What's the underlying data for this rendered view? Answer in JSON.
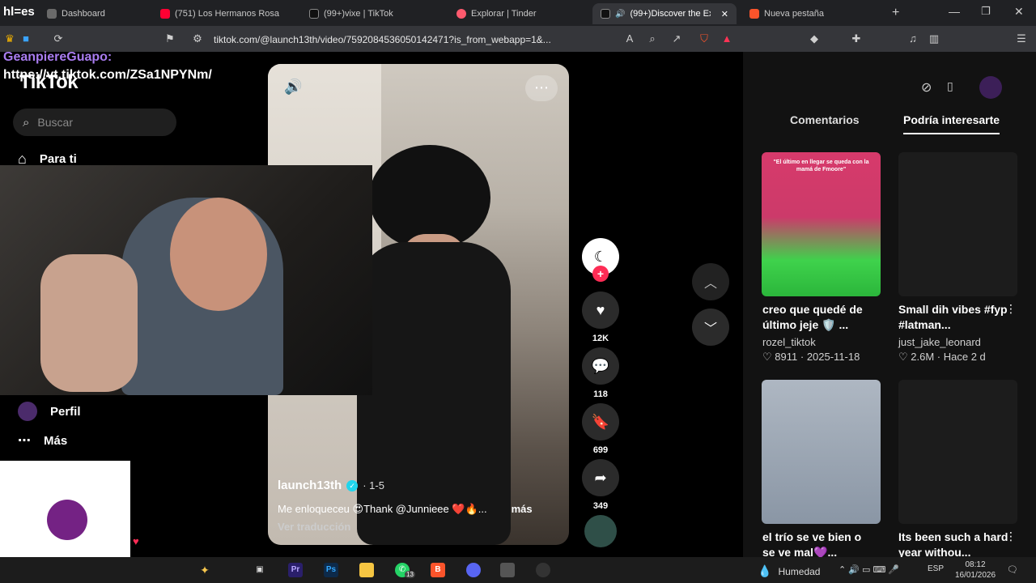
{
  "tabs": [
    {
      "label": "Dashboard"
    },
    {
      "label": "(751) Los Hermanos Rosa"
    },
    {
      "label": "(99+)vixe | TikTok"
    },
    {
      "label": "Explorar | Tinder"
    },
    {
      "label": "(99+)Discover the Ex"
    },
    {
      "label": "Nueva pestaña"
    }
  ],
  "address": {
    "url": "tiktok.com/@launch13th/video/7592084536050142471?is_from_webapp=1&..."
  },
  "overlay": {
    "hl_tag": "hl=es",
    "chat_user": "GeanpiereGuapo:",
    "chat_message": "https://vt.tiktok.com/ZSa1NPYNm/"
  },
  "tiktok": {
    "logo": "TikTok",
    "search_placeholder": "Buscar",
    "nav": [
      {
        "label": "Para ti"
      },
      {
        "label": "Perfil"
      },
      {
        "label": "Más"
      }
    ]
  },
  "video": {
    "author": "launch13th",
    "date": "· 1-5",
    "caption": "Me enloqueceu 😍Thank @Junnieee ❤️🔥...",
    "more": "más",
    "translate": "Ver traducción",
    "likes": "12K",
    "comments": "118",
    "saves": "699",
    "shares": "349"
  },
  "panel": {
    "tab_comments": "Comentarios",
    "tab_interest": "Podría interesarte",
    "cards": [
      {
        "title": "creo que quedé de último jeje 🛡️ ...",
        "author": "rozel_tiktok",
        "likes": "8911",
        "date": "2025-11-18",
        "thumb_text": "\"El último en llegar se queda con la mamá de Fmoore\""
      },
      {
        "title": "Small dih vibes #fyp #latman...",
        "author": "just_jake_leonard",
        "likes": "2.6M",
        "date": "Hace 2 d",
        "thumb_text": ""
      },
      {
        "title": "el trío se ve bien o se ve mal💜...",
        "author": "",
        "likes": "",
        "date": "",
        "thumb_text": ""
      },
      {
        "title": "Its been such a hard year withou...",
        "author": "",
        "likes": "",
        "date": "",
        "thumb_text": ""
      }
    ]
  },
  "taskbar": {
    "weather": "Humedad",
    "lang": "ESP",
    "time": "08:12",
    "date": "16/01/2026",
    "whatsapp_badge": "13"
  },
  "colors": {
    "accent": "#fe2c55",
    "verified": "#20d5ec",
    "chat_user": "#a97cf0"
  }
}
